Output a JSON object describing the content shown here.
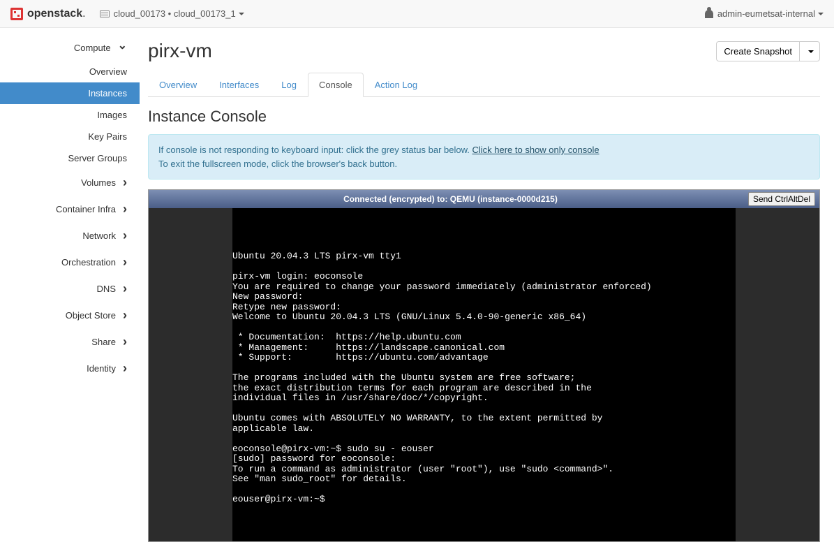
{
  "topnav": {
    "brand": "openstack",
    "project_label": "cloud_00173 • cloud_00173_1",
    "user_label": "admin-eumetsat-internal"
  },
  "sidebar": {
    "compute_label": "Compute",
    "compute_items": {
      "overview": "Overview",
      "instances": "Instances",
      "images": "Images",
      "keypairs": "Key Pairs",
      "servergroups": "Server Groups"
    },
    "other": {
      "volumes": "Volumes",
      "container_infra": "Container Infra",
      "network": "Network",
      "orchestration": "Orchestration",
      "dns": "DNS",
      "object_store": "Object Store",
      "share": "Share",
      "identity": "Identity"
    }
  },
  "page": {
    "title": "pirx-vm",
    "snapshot_btn": "Create Snapshot"
  },
  "tabs": {
    "overview": "Overview",
    "interfaces": "Interfaces",
    "log": "Log",
    "console": "Console",
    "actionlog": "Action Log"
  },
  "section": {
    "title": "Instance Console",
    "alert_line1_a": "If console is not responding to keyboard input: click the grey status bar below. ",
    "alert_link": "Click here to show only console",
    "alert_line2": "To exit the fullscreen mode, click the browser's back button."
  },
  "console": {
    "status": "Connected (encrypted) to: QEMU (instance-0000d215)",
    "cad_btn": "Send CtrlAltDel",
    "text": "Ubuntu 20.04.3 LTS pirx-vm tty1\n\npirx-vm login: eoconsole\nYou are required to change your password immediately (administrator enforced)\nNew password:\nRetype new password:\nWelcome to Ubuntu 20.04.3 LTS (GNU/Linux 5.4.0-90-generic x86_64)\n\n * Documentation:  https://help.ubuntu.com\n * Management:     https://landscape.canonical.com\n * Support:        https://ubuntu.com/advantage\n\nThe programs included with the Ubuntu system are free software;\nthe exact distribution terms for each program are described in the\nindividual files in /usr/share/doc/*/copyright.\n\nUbuntu comes with ABSOLUTELY NO WARRANTY, to the extent permitted by\napplicable law.\n\neoconsole@pirx-vm:~$ sudo su - eouser\n[sudo] password for eoconsole:\nTo run a command as administrator (user \"root\"), use \"sudo <command>\".\nSee \"man sudo_root\" for details.\n\neouser@pirx-vm:~$ "
  }
}
